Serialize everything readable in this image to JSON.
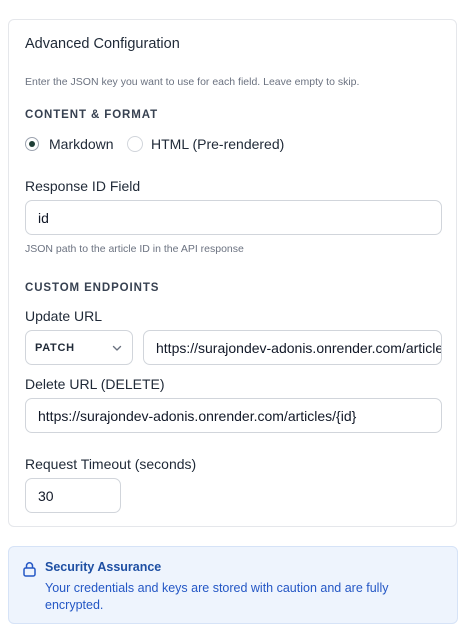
{
  "config": {
    "title": "Advanced Configuration",
    "hint": "Enter the JSON key you want to use for each field. Leave empty to skip.",
    "content_section": "CONTENT & FORMAT",
    "format_options": [
      {
        "label": "Markdown",
        "selected": true
      },
      {
        "label": "HTML (Pre-rendered)",
        "selected": false
      }
    ],
    "response_id": {
      "label": "Response ID Field",
      "value": "id",
      "help": "JSON path to the article ID in the API response"
    },
    "endpoints_section": "CUSTOM ENDPOINTS",
    "update_url": {
      "label": "Update URL",
      "method": "PATCH",
      "value": "https://surajondev-adonis.onrender.com/articles/{id}"
    },
    "delete_url": {
      "label": "Delete URL (DELETE)",
      "value": "https://surajondev-adonis.onrender.com/articles/{id}"
    },
    "timeout": {
      "label": "Request Timeout (seconds)",
      "value": "30"
    }
  },
  "security": {
    "title": "Security Assurance",
    "text": "Your credentials and keys are stored with caution and are fully encrypted.",
    "icon": "lock-icon"
  },
  "colors": {
    "accent_dark": "#1f3f36",
    "info_bg": "#eef4fd",
    "info_text": "#2457c5"
  }
}
